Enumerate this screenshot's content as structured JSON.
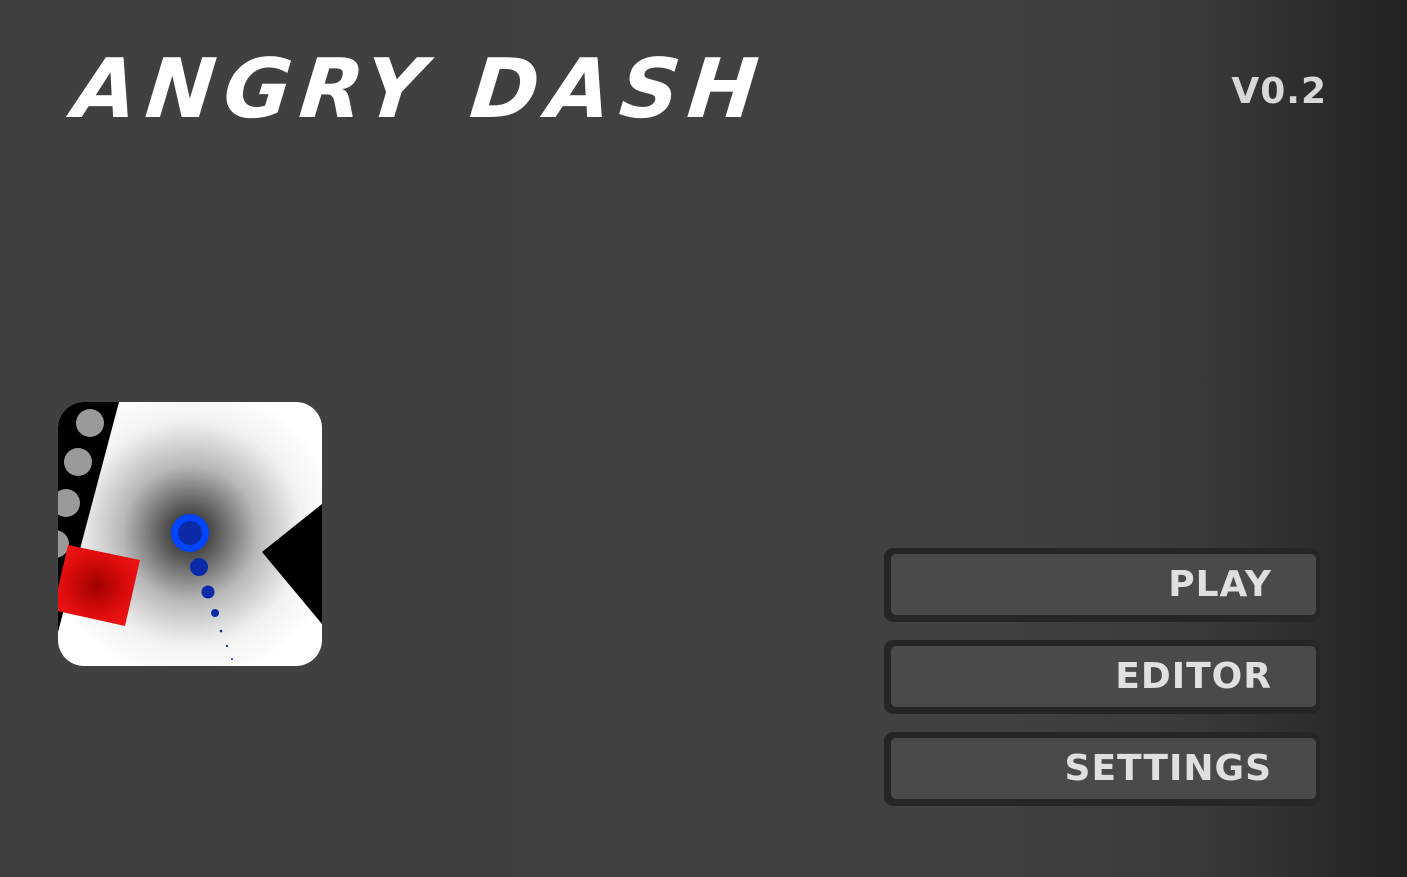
{
  "title": "ANGRY DASH",
  "version": "V0.2",
  "logo": {
    "icon": "angry-dash-game-logo",
    "colors": {
      "background": "#ffffff",
      "player": "#0044ff",
      "player_core": "#0a2aa8",
      "block": "#e81010",
      "spike": "#000000",
      "wall": "#000000",
      "wall_dots": "#9a9a9a"
    }
  },
  "menu": {
    "items": [
      {
        "label": "PLAY"
      },
      {
        "label": "EDITOR"
      },
      {
        "label": "SETTINGS"
      }
    ]
  },
  "colors": {
    "background": "#404040",
    "button_border": "#262626",
    "button_fill": "#4a4a4a",
    "button_text": "#e0e0e0",
    "title_text": "#ffffff"
  }
}
